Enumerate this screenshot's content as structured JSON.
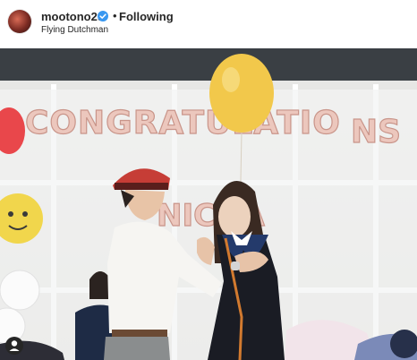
{
  "post": {
    "username": "mootono29",
    "follow_state": "Following",
    "separator": "•",
    "location": "Flying Dutchman"
  },
  "icons": {
    "avatar": "profile-avatar",
    "verified": "verified-badge-icon",
    "tag": "user-tag-icon"
  },
  "photo": {
    "balloon_text": [
      "CONGRATULATIONS",
      "NICHA"
    ]
  },
  "colors": {
    "verified_blue": "#3897f0",
    "balloon_rose": "#e9bfb5",
    "balloon_gold": "#f2c84b",
    "balloon_red": "#e9474b",
    "gown_navy": "#1e2b45"
  }
}
